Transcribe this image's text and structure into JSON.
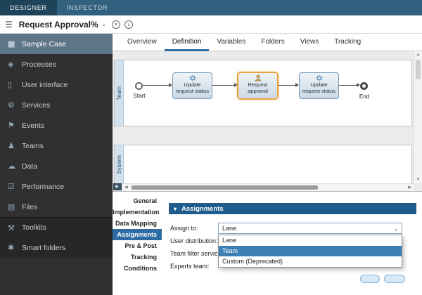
{
  "topbar": {
    "designer": "DESIGNER",
    "inspector": "INSPECTOR"
  },
  "toolbar": {
    "title": "Request Approval%"
  },
  "icons": {
    "menu": "☰",
    "chev_down": "⌄",
    "close": "✕",
    "info": "i",
    "collapse": "▾",
    "select_arrow": "⌄",
    "up": "▲",
    "down": "▼",
    "left": "◀",
    "right": "▶"
  },
  "sidebar": {
    "items": [
      {
        "label": "Sample Case",
        "glyph": "▦"
      },
      {
        "label": "Processes",
        "glyph": "◈"
      },
      {
        "label": "User interface",
        "glyph": "▯"
      },
      {
        "label": "Services",
        "glyph": "⚙"
      },
      {
        "label": "Events",
        "glyph": "⚑"
      },
      {
        "label": "Teams",
        "glyph": "♟"
      },
      {
        "label": "Data",
        "glyph": "☁"
      },
      {
        "label": "Performance",
        "glyph": "☑"
      },
      {
        "label": "Files",
        "glyph": "▤"
      },
      {
        "label": "Toolkits",
        "glyph": "⚒"
      },
      {
        "label": "Smart folders",
        "glyph": "✱"
      }
    ]
  },
  "tabs": {
    "active": "Definition",
    "items": [
      {
        "label": "Overview"
      },
      {
        "label": "Definition"
      },
      {
        "label": "Variables"
      },
      {
        "label": "Folders"
      },
      {
        "label": "Views"
      },
      {
        "label": "Tracking"
      }
    ]
  },
  "diagram": {
    "lanes": {
      "team": "Team",
      "system": "System"
    },
    "nodes": {
      "start": "Start",
      "task1": "Update request status",
      "task2": "Request approval",
      "task3": "Update request status",
      "end": "End"
    },
    "selected_node": "Request approval"
  },
  "properties": {
    "active": "Assignments",
    "header": "Assignments",
    "menu": [
      {
        "label": "General"
      },
      {
        "label": "Implementation"
      },
      {
        "label": "Data Mapping"
      },
      {
        "label": "Assignments"
      },
      {
        "label": "Pre & Post"
      },
      {
        "label": "Tracking"
      },
      {
        "label": "Conditions"
      }
    ],
    "fields": [
      {
        "label": "Assign to:"
      },
      {
        "label": "User distribution:"
      },
      {
        "label": "Team filter service:"
      },
      {
        "label": "Experts team:"
      }
    ],
    "assign_to_value": "Lane",
    "dropdown": {
      "highlighted": "Team",
      "options": [
        {
          "label": "Lane"
        },
        {
          "label": "Team"
        },
        {
          "label": "Custom (Deprecated)"
        }
      ]
    }
  },
  "colors": {
    "accent_blue": "#2e6da4",
    "selection_orange": "#e9a13b",
    "panel_header_blue": "#1f5c8b",
    "topbar_blue": "#32617f",
    "sidebar_selected": "#5e7788"
  }
}
